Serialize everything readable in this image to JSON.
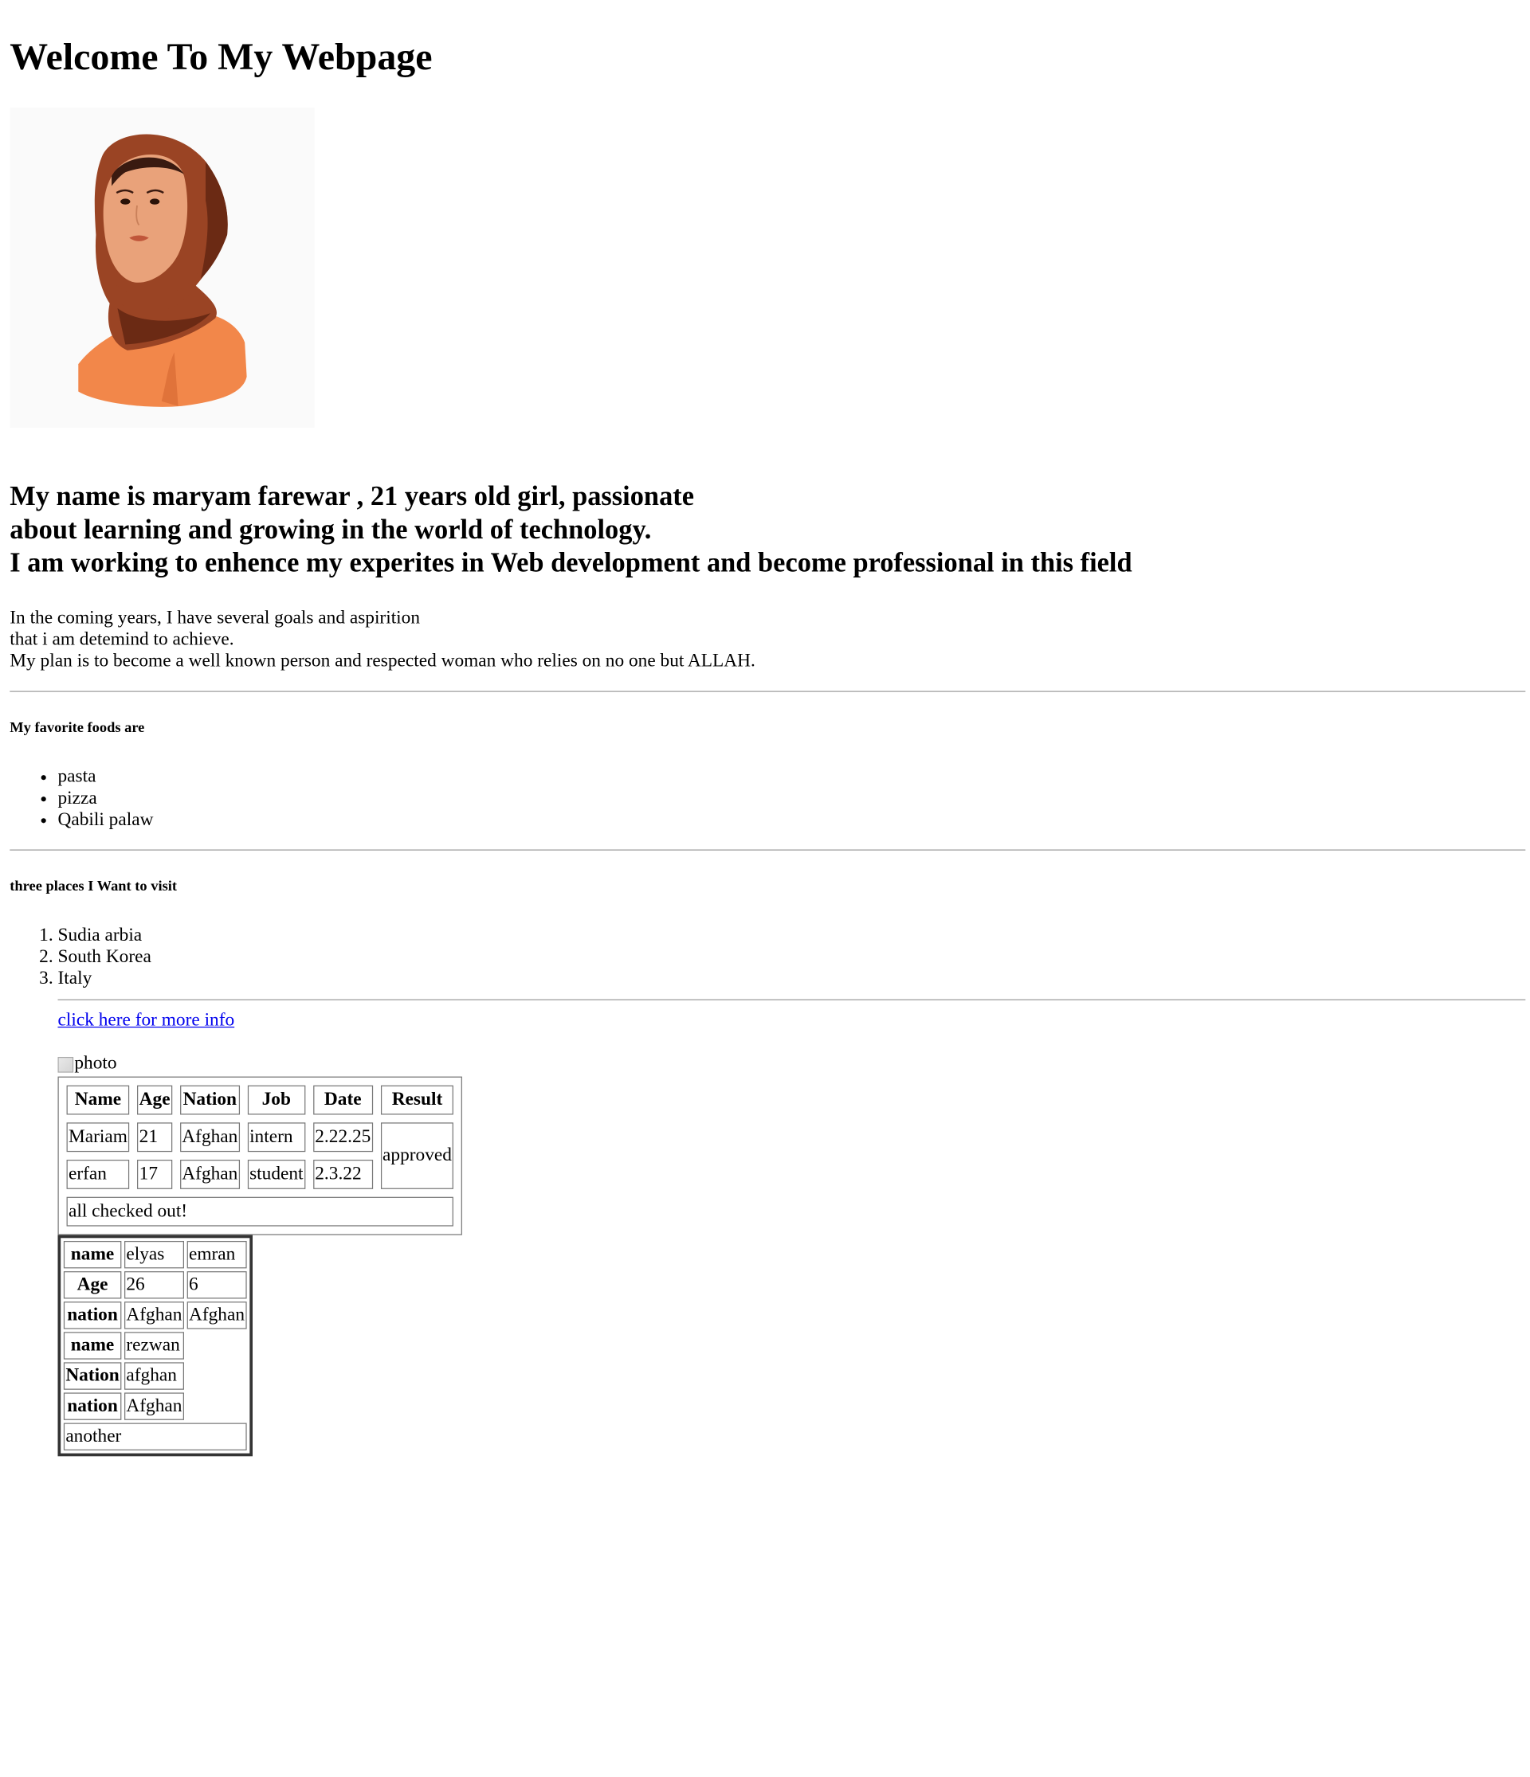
{
  "header": {
    "title": "Welcome To My Webpage"
  },
  "portrait": {
    "icon": "woman-hijab-illustration",
    "colors": {
      "scarf": "#9a4424",
      "scarf_dark": "#6b2a14",
      "skin": "#e9a27a",
      "shirt": "#f2874a",
      "background": "#fafafa"
    }
  },
  "intro": {
    "line1": "My name is maryam farewar , 21 years old girl, passionate",
    "line2": "about learning and growing in the world of technology.",
    "line3": "I am working to enhence my experites in Web development and become professional in this field"
  },
  "bio": {
    "line1": "In the coming years, I have several goals and aspirition",
    "line2": "that i am detemind to achieve.",
    "line3": "My plan is to become a well known person and respected woman who relies on no one but ALLAH."
  },
  "foods": {
    "heading": "My favorite foods are",
    "items": [
      "pasta",
      "pizza",
      "Qabili palaw"
    ]
  },
  "places": {
    "heading": "three places I Want to visit",
    "items": [
      "Sudia arbia",
      "South Korea",
      "Italy"
    ]
  },
  "link": {
    "label": "click here for more info"
  },
  "photo": {
    "alt": "photo"
  },
  "table1": {
    "headers": [
      "Name",
      "Age",
      "Nation",
      "Job",
      "Date",
      "Result"
    ],
    "rows": [
      [
        "Mariam",
        "21",
        "Afghan",
        "intern",
        "2.22.25"
      ],
      [
        "erfan",
        "17",
        "Afghan",
        "student",
        "2.3.22"
      ]
    ],
    "result": "approved",
    "footer": "all checked out!"
  },
  "table2": {
    "rows": [
      {
        "header": "name",
        "cells": [
          "elyas",
          "emran"
        ]
      },
      {
        "header": "Age",
        "cells": [
          "26",
          "6"
        ]
      },
      {
        "header": "nation",
        "cells": [
          "Afghan",
          "Afghan"
        ]
      },
      {
        "header": "name",
        "cells": [
          "rezwan"
        ]
      },
      {
        "header": "Nation",
        "cells": [
          "afghan"
        ]
      },
      {
        "header": "nation",
        "cells": [
          "Afghan"
        ]
      }
    ],
    "footer": "another"
  }
}
